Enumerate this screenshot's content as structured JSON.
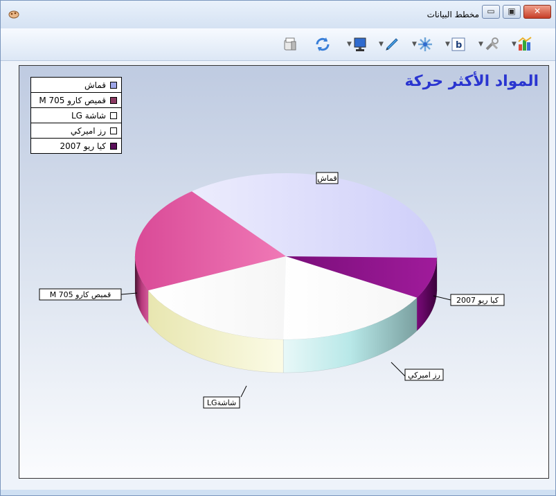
{
  "window": {
    "title": "مخطط البيانات",
    "close_glyph": "✕",
    "maximize_glyph": "▣",
    "minimize_glyph": "▭"
  },
  "toolbar": {
    "icons": [
      "print-icon",
      "refresh-icon",
      "monitor-icon",
      "pencil-icon",
      "gear-3d-icon",
      "bold-icon",
      "tools-icon",
      "chart-type-icon"
    ]
  },
  "chart_data": {
    "type": "pie",
    "title": "المواد الأكثر حركة",
    "slices": [
      {
        "label": "قماش",
        "value": 36,
        "color": "#d8d8fb"
      },
      {
        "label": "قميص كارو  M 705",
        "value": 21,
        "color": "#e85fa6"
      },
      {
        "label": "شاشة LG",
        "value": 18,
        "color": "#ffffff"
      },
      {
        "label": "رز اميركي",
        "value": 17,
        "color": "#ffffff"
      },
      {
        "label": "كيا ريو 2007",
        "value": 8,
        "color": "#8c1388"
      }
    ],
    "legend": [
      {
        "label": "قماش",
        "color": "#9ea6e8"
      },
      {
        "label": "قميص كارو  M 705",
        "color": "#8b3a62"
      },
      {
        "label": "شاشة LG",
        "color": "#ffffff"
      },
      {
        "label": "رز اميركي",
        "color": "#ffffff"
      },
      {
        "label": "كيا ريو 2007",
        "color": "#5a0f5a"
      }
    ],
    "callout_labels": {
      "fabric": "قماش",
      "shirt": "M 705  قميص كارو",
      "screen": "LGشاشة",
      "rice": "رز اميركي",
      "kia": "كيا ريو 2007"
    },
    "legend_position": "top-left",
    "view": "3d"
  }
}
